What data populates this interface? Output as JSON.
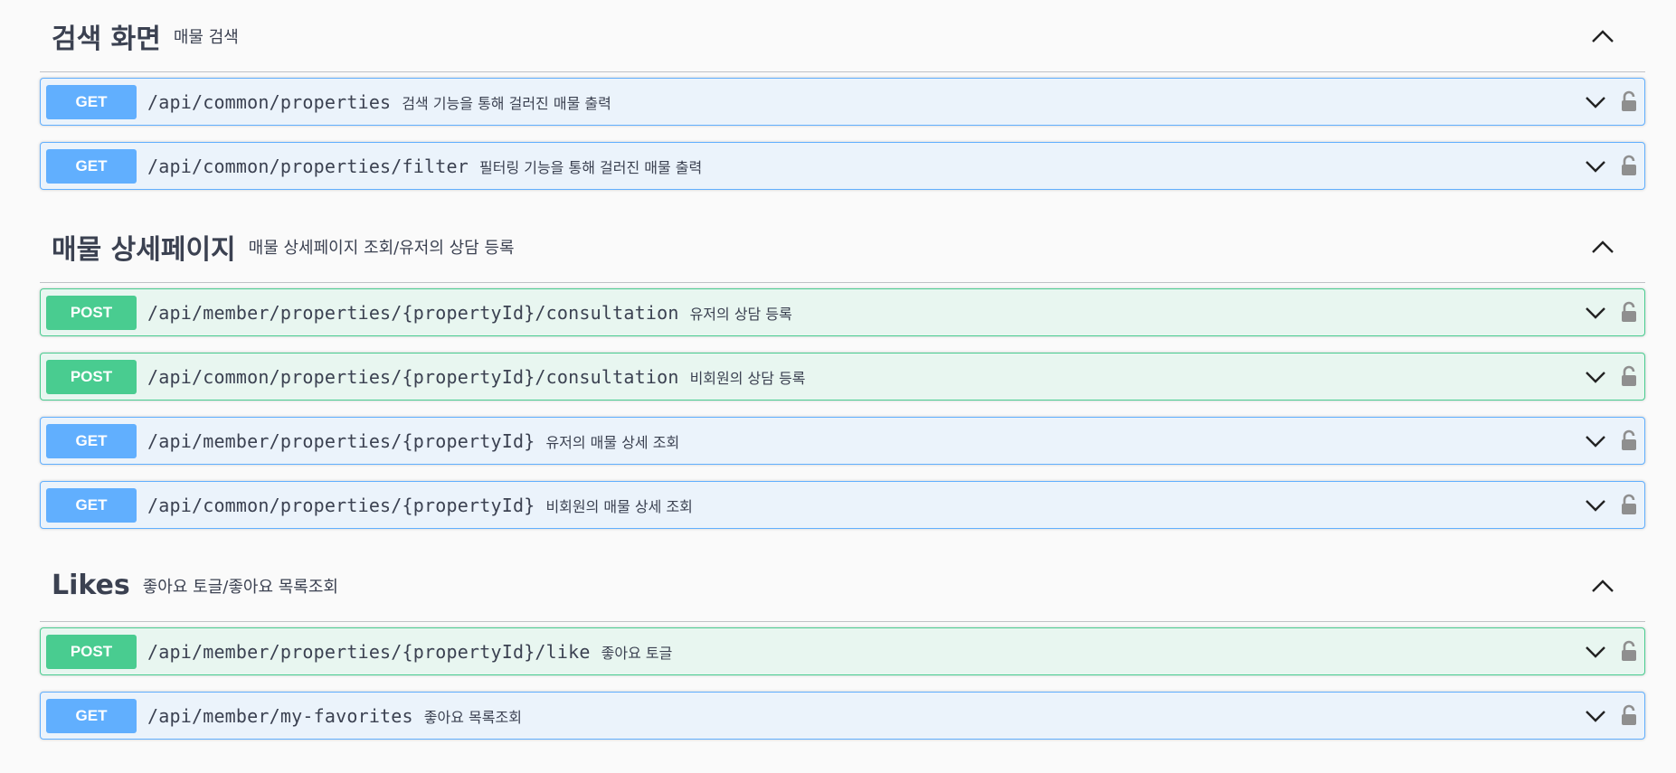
{
  "sections": [
    {
      "title": "검색 화면",
      "description": "매물 검색",
      "operations": [
        {
          "method": "GET",
          "path": "/api/common/properties",
          "summary": "검색 기능을 통해 걸러진 매물 출력"
        },
        {
          "method": "GET",
          "path": "/api/common/properties/filter",
          "summary": "필터링 기능을 통해 걸러진 매물 출력"
        }
      ]
    },
    {
      "title": "매물 상세페이지",
      "description": "매물 상세페이지 조회/유저의 상담 등록",
      "operations": [
        {
          "method": "POST",
          "path": "/api/member/properties/{propertyId}/consultation",
          "summary": "유저의 상담 등록"
        },
        {
          "method": "POST",
          "path": "/api/common/properties/{propertyId}/consultation",
          "summary": "비회원의 상담 등록"
        },
        {
          "method": "GET",
          "path": "/api/member/properties/{propertyId}",
          "summary": "유저의 매물 상세 조회"
        },
        {
          "method": "GET",
          "path": "/api/common/properties/{propertyId}",
          "summary": "비회원의 매물 상세 조회"
        }
      ]
    },
    {
      "title": "Likes",
      "description": "좋아요 토글/좋아요 목록조회",
      "operations": [
        {
          "method": "POST",
          "path": "/api/member/properties/{propertyId}/like",
          "summary": "좋아요 토글"
        },
        {
          "method": "GET",
          "path": "/api/member/my-favorites",
          "summary": "좋아요 목록조회"
        }
      ]
    }
  ],
  "colors": {
    "get": "#61affe",
    "post": "#49cc90",
    "get_bg": "#ebf3fb",
    "post_bg": "#e8f6f0",
    "text": "#3b4151"
  },
  "icons": {
    "collapse": "chevron-up-icon",
    "expand": "chevron-down-icon",
    "auth": "lock-icon"
  }
}
